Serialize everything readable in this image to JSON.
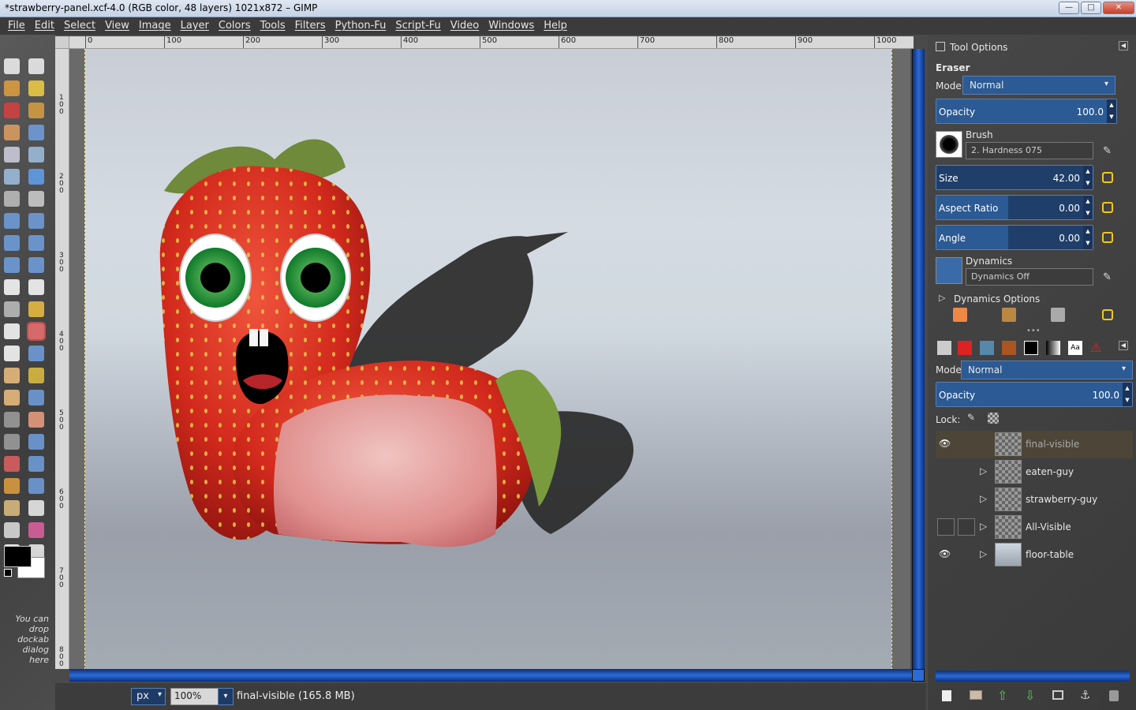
{
  "window": {
    "title": "*strawberry-panel.xcf-4.0 (RGB color, 48 layers) 1021x872 – GIMP",
    "buttons": [
      "minimize-icon",
      "maximize-icon",
      "close-icon"
    ]
  },
  "menu": [
    "File",
    "Edit",
    "Select",
    "View",
    "Image",
    "Layer",
    "Colors",
    "Tools",
    "Filters",
    "Python-Fu",
    "Script-Fu",
    "Video",
    "Windows",
    "Help"
  ],
  "ruler": {
    "top_ticks": [
      "0",
      "100",
      "200",
      "300",
      "400",
      "500",
      "600",
      "700",
      "800",
      "900",
      "1000"
    ],
    "left_ticks": [
      "100",
      "200",
      "300",
      "400",
      "500",
      "600",
      "700",
      "800"
    ]
  },
  "toolbox": {
    "drop_hint": "You can drop dockab dialog here",
    "fg_color": "#000000",
    "bg_color": "#ffffff"
  },
  "tool_options": {
    "panel_title": "Tool Options",
    "tool_name": "Eraser",
    "mode_label": "Mode:",
    "mode_value": "Normal",
    "opacity_label": "Opacity",
    "opacity_value": "100.0",
    "brush_label": "Brush",
    "brush_value": "2. Hardness 075",
    "size_label": "Size",
    "size_value": "42.00",
    "aspect_label": "Aspect Ratio",
    "aspect_value": "0.00",
    "angle_label": "Angle",
    "angle_value": "0.00",
    "dynamics_label": "Dynamics",
    "dynamics_value": "Dynamics Off",
    "dynamics_options_label": "Dynamics Options"
  },
  "layers": {
    "mode_label": "Mode:",
    "mode_value": "Normal",
    "opacity_label": "Opacity",
    "opacity_value": "100.0",
    "lock_label": "Lock:",
    "items": [
      {
        "name": "final-visible",
        "visible": true,
        "selected": true
      },
      {
        "name": "eaten-guy",
        "visible": false,
        "selected": false
      },
      {
        "name": "strawberry-guy",
        "visible": false,
        "selected": false
      },
      {
        "name": "All-Visible",
        "visible": false,
        "selected": false
      },
      {
        "name": "floor-table",
        "visible": true,
        "selected": false
      }
    ]
  },
  "status": {
    "unit": "px",
    "zoom": "100",
    "zoom_suffix": "%",
    "message": "final-visible (165.8 MB)"
  },
  "colors": {
    "accent": "#2b5a94",
    "scrollbar": "#2d6ad6",
    "lock_icon": "#f2c81a"
  }
}
